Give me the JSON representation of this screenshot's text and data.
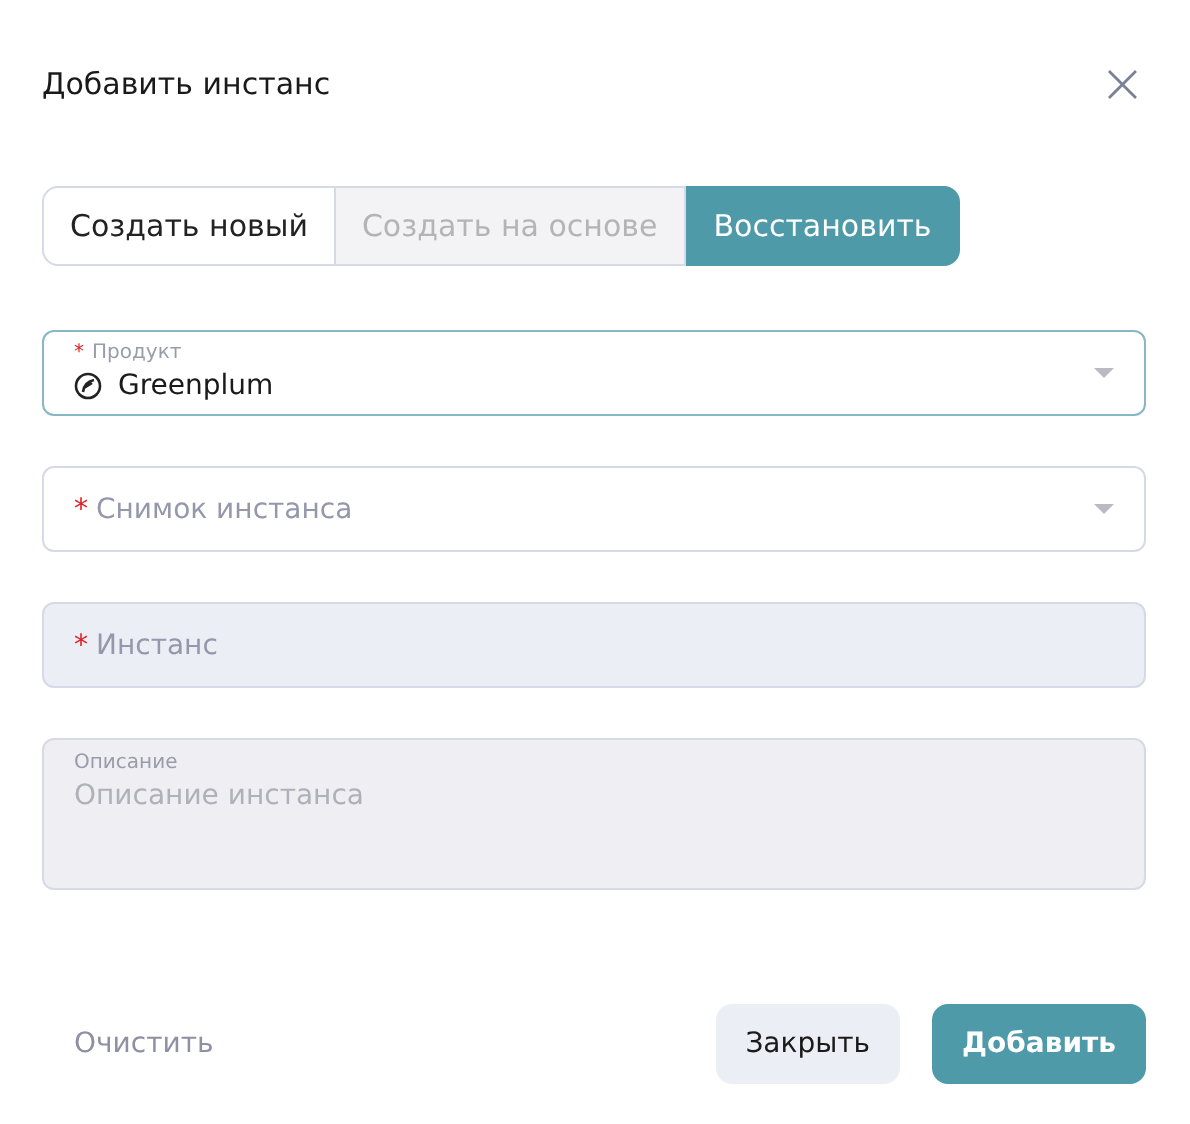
{
  "dialog": {
    "title": "Добавить инстанс",
    "close_icon": "×"
  },
  "tabs": [
    {
      "label": "Создать новый",
      "selected": false,
      "disabled": false
    },
    {
      "label": "Создать на основе",
      "selected": false,
      "disabled": true
    },
    {
      "label": "Восстановить",
      "selected": true,
      "disabled": false
    }
  ],
  "fields": [
    {
      "kind": "select",
      "required_mark": "*",
      "label": "Продукт",
      "value": "Greenplum",
      "focused": true,
      "disabled": false
    },
    {
      "kind": "select",
      "required_mark": "*",
      "placeholder": "Снимок инстанса",
      "focused": false,
      "disabled": false
    },
    {
      "kind": "input",
      "required_mark": "*",
      "placeholder": "Инстанс",
      "focused": false,
      "disabled": true
    },
    {
      "kind": "textarea",
      "label": "Описание",
      "placeholder": "Описание инстанса",
      "focused": false,
      "disabled": true
    }
  ],
  "footer": {
    "clear": "Очистить",
    "buttons": [
      {
        "label": "Закрыть",
        "kind": "secondary"
      },
      {
        "label": "Добавить",
        "kind": "primary"
      }
    ]
  }
}
